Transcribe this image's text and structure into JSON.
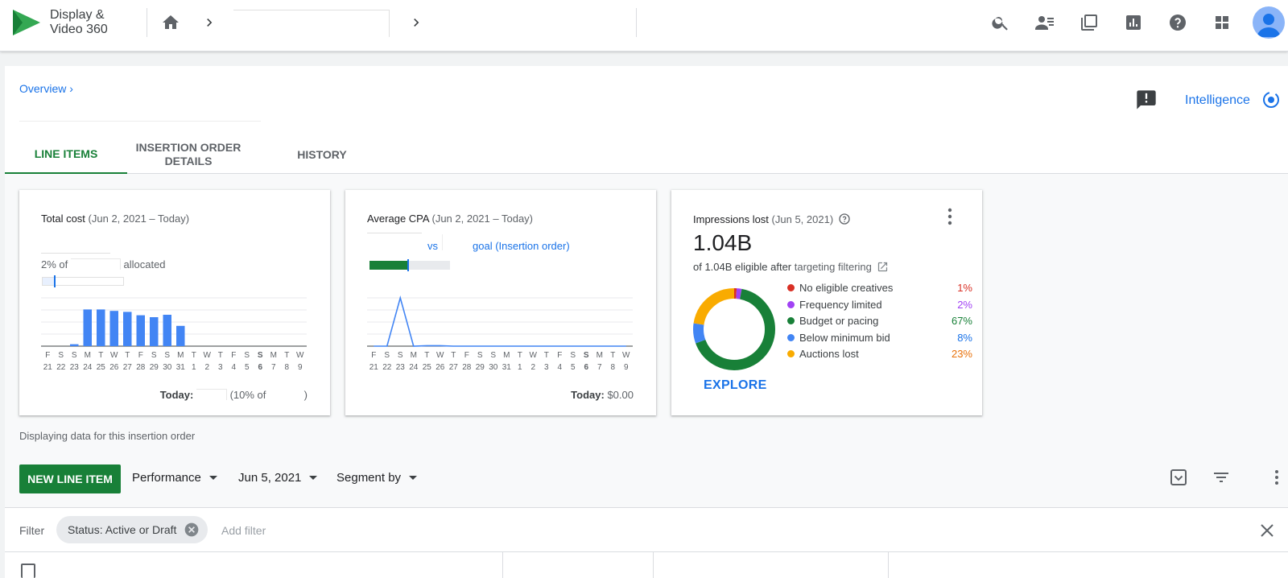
{
  "app": {
    "name_line1": "Display &",
    "name_line2": "Video 360"
  },
  "colors": {
    "brand_green": "#188038",
    "link_blue": "#1a73e8",
    "bar_blue": "#4285f4"
  },
  "topbar_icons": [
    "search-icon",
    "account-switch-icon",
    "copy-icon",
    "report-icon",
    "help-icon",
    "apps-icon",
    "avatar"
  ],
  "header": {
    "overview_link": "Overview ›",
    "intelligence_label": "Intelligence"
  },
  "tabs": [
    {
      "label_line1": "LINE ITEMS",
      "label_line2": ""
    },
    {
      "label_line1": "INSERTION ORDER",
      "label_line2": "DETAILS"
    },
    {
      "label_line1": "HISTORY",
      "label_line2": ""
    }
  ],
  "cards": {
    "total_cost": {
      "title": "Total cost",
      "range": "(Jun 2, 2021 – Today)",
      "pct_text": "2% of",
      "allocated": "allocated",
      "today_label": "Today:",
      "today_pct_open": "(10% of",
      "today_close": ")"
    },
    "avg_cpa": {
      "title": "Average CPA",
      "range": "(Jun 2, 2021 – Today)",
      "vs": "vs",
      "goal": "goal (Insertion order)",
      "today_label": "Today:",
      "today_value": "$0.00"
    },
    "impressions_lost": {
      "title": "Impressions lost",
      "range": "(Jun 5, 2021)",
      "big_number": "1.04B",
      "eligible_text": "of 1.04B eligible after",
      "targeting_link": "targeting filtering",
      "explore": "EXPLORE",
      "legend": [
        {
          "label": "No eligible creatives",
          "pct": "1%",
          "color": "#d93025"
        },
        {
          "label": "Frequency limited",
          "pct": "2%",
          "color": "#a142f4"
        },
        {
          "label": "Budget or pacing",
          "pct": "67%",
          "color": "#188038"
        },
        {
          "label": "Below minimum bid",
          "pct": "8%",
          "color": "#4285f4"
        },
        {
          "label": "Auctions lost",
          "pct": "23%",
          "color": "#f9ab00"
        }
      ],
      "pct_colors": [
        "#d93025",
        "#a142f4",
        "#188038",
        "#1a73e8",
        "#e8710a"
      ]
    }
  },
  "chart_data": [
    {
      "type": "bar",
      "categories": [
        "21",
        "22",
        "23",
        "24",
        "25",
        "26",
        "27",
        "28",
        "29",
        "30",
        "31",
        "1",
        "2",
        "3",
        "4",
        "5",
        "6",
        "7",
        "8",
        "9"
      ],
      "weekdays": [
        "F",
        "S",
        "S",
        "M",
        "T",
        "W",
        "T",
        "F",
        "S",
        "S",
        "M",
        "T",
        "W",
        "T",
        "F",
        "S",
        "S",
        "M",
        "T",
        "W"
      ],
      "bold_index": 16,
      "values": [
        0,
        0,
        0.4,
        7.6,
        7.6,
        7.3,
        7.1,
        6.4,
        6.0,
        6.5,
        4.2,
        0,
        0,
        0,
        0,
        0,
        0,
        0,
        0,
        0
      ],
      "ylim": [
        0,
        10
      ],
      "title": "Total cost"
    },
    {
      "type": "line",
      "categories": [
        "21",
        "22",
        "23",
        "24",
        "25",
        "26",
        "27",
        "28",
        "29",
        "30",
        "31",
        "1",
        "2",
        "3",
        "4",
        "5",
        "6",
        "7",
        "8",
        "9"
      ],
      "weekdays": [
        "F",
        "S",
        "S",
        "M",
        "T",
        "W",
        "T",
        "F",
        "S",
        "S",
        "M",
        "T",
        "W",
        "T",
        "F",
        "S",
        "S",
        "M",
        "T",
        "W"
      ],
      "bold_index": 16,
      "values": [
        0,
        0,
        10,
        0,
        0.1,
        0.1,
        0,
        0,
        0,
        0,
        0,
        0,
        0,
        0,
        0,
        0,
        0,
        0,
        0,
        0
      ],
      "ylim": [
        0,
        10
      ],
      "title": "Average CPA"
    },
    {
      "type": "pie",
      "title": "Impressions lost",
      "labels": [
        "No eligible creatives",
        "Frequency limited",
        "Budget or pacing",
        "Below minimum bid",
        "Auctions lost"
      ],
      "values": [
        1,
        2,
        67,
        8,
        23
      ]
    }
  ],
  "footer_note": "Displaying data for this insertion order",
  "toolbar": {
    "new_line_item": "NEW LINE ITEM",
    "performance": "Performance",
    "date": "Jun 5, 2021",
    "segment": "Segment by"
  },
  "filter": {
    "label": "Filter",
    "chip": "Status: Active or Draft",
    "add_filter": "Add filter"
  }
}
